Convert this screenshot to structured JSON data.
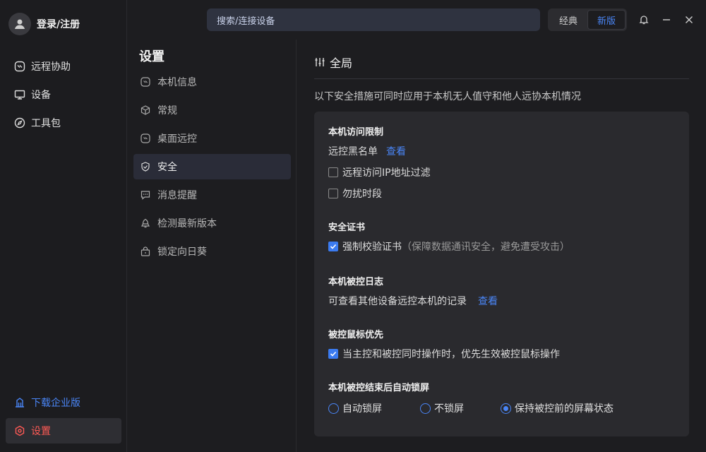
{
  "user": {
    "login_label": "登录/注册",
    "avatar_icon": "user-icon"
  },
  "nav": {
    "items": [
      {
        "label": "远程协助",
        "icon": "remote-assist-icon"
      },
      {
        "label": "设备",
        "icon": "monitor-icon"
      },
      {
        "label": "工具包",
        "icon": "compass-icon"
      }
    ],
    "enterprise_label": "下载企业版",
    "settings_label": "设置"
  },
  "topbar": {
    "search_placeholder": "搜索/连接设备",
    "mode_classic": "经典",
    "mode_new": "新版"
  },
  "settings": {
    "title": "设置",
    "items": [
      {
        "label": "本机信息",
        "icon": "device-info-icon"
      },
      {
        "label": "常规",
        "icon": "cube-icon"
      },
      {
        "label": "桌面远控",
        "icon": "desktop-remote-icon"
      },
      {
        "label": "安全",
        "icon": "shield-icon",
        "active": true
      },
      {
        "label": "消息提醒",
        "icon": "message-icon"
      },
      {
        "label": "检测最新版本",
        "icon": "update-icon"
      },
      {
        "label": "锁定向日葵",
        "icon": "lock-icon"
      }
    ]
  },
  "main": {
    "header": "全局",
    "description": "以下安全措施可同时应用于本机无人值守和他人远协本机情况",
    "access_limit": {
      "title": "本机访问限制",
      "blacklist_label": "远控黑名单",
      "blacklist_link": "查看",
      "ip_filter": "远程访问IP地址过滤",
      "dnd": "勿扰时段"
    },
    "cert": {
      "title": "安全证书",
      "force_verify": "强制校验证书",
      "force_verify_hint": "（保障数据通讯安全，避免遭受攻击）"
    },
    "log": {
      "title": "本机被控日志",
      "desc": "可查看其他设备远控本机的记录",
      "link": "查看"
    },
    "mouse": {
      "title": "被控鼠标优先",
      "option": "当主控和被控同时操作时，优先生效被控鼠标操作"
    },
    "lock": {
      "title": "本机被控结束后自动锁屏",
      "opt_auto": "自动锁屏",
      "opt_none": "不锁屏",
      "opt_keep": "保持被控前的屏幕状态"
    }
  },
  "colors": {
    "accent": "#4a86f7",
    "danger": "#ff5a55",
    "bg": "#1d1d20",
    "card": "#2a2a2e"
  }
}
